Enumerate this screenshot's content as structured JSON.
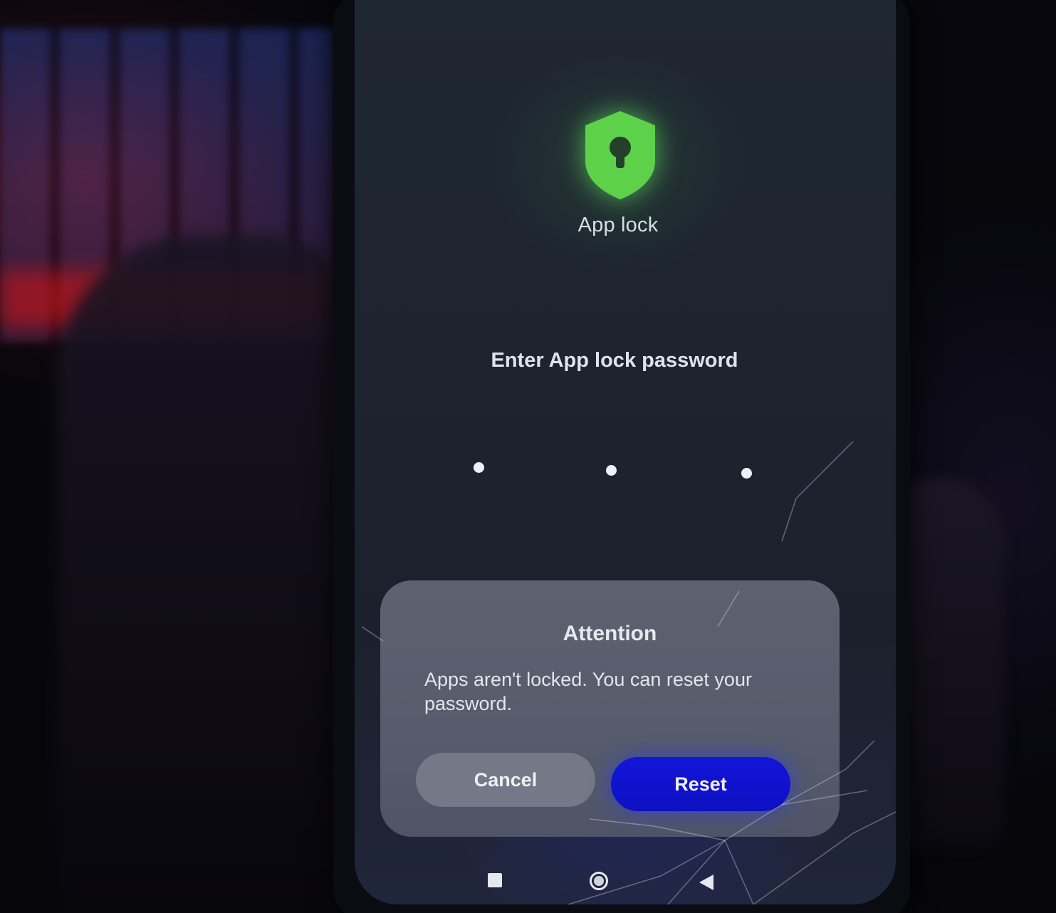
{
  "app": {
    "title": "App lock",
    "icon": "shield-keyhole-icon",
    "accent_color": "#5ed14a"
  },
  "lock_screen": {
    "prompt": "Enter App lock password",
    "pin_dots_count": 3
  },
  "dialog": {
    "title": "Attention",
    "message": "Apps aren't locked. You can reset your password.",
    "cancel_label": "Cancel",
    "reset_label": "Reset",
    "reset_color": "#1014d0"
  },
  "navigation_bar": {
    "recent_icon": "square-recent-icon",
    "home_icon": "circle-home-icon",
    "back_icon": "triangle-back-icon"
  }
}
